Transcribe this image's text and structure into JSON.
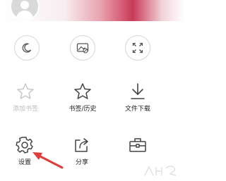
{
  "menu": {
    "tools": [
      {
        "name": "night-mode",
        "icon": "moon-icon",
        "label": ""
      },
      {
        "name": "no-image-mode",
        "icon": "image-off-icon",
        "label": ""
      },
      {
        "name": "fullscreen",
        "icon": "fullscreen-icon",
        "label": ""
      },
      {
        "name": "add-bookmark",
        "icon": "star-icon",
        "label": "添加书签",
        "enabled": false
      },
      {
        "name": "bookmarks-history",
        "icon": "star-icon",
        "label": "书签/历史",
        "enabled": true
      },
      {
        "name": "file-download",
        "icon": "download-icon",
        "label": "文件下载",
        "enabled": true
      },
      {
        "name": "settings",
        "icon": "gear-icon",
        "label": "设置",
        "enabled": true
      },
      {
        "name": "share",
        "icon": "share-icon",
        "label": "分享",
        "enabled": true
      },
      {
        "name": "toolbox",
        "icon": "toolbox-icon",
        "label": "",
        "enabled": true
      }
    ]
  },
  "annotation": {
    "color": "#e23b3b",
    "icon": "arrow-icon"
  },
  "colors": {
    "banner_accent": "#c93a57",
    "icon_stroke": "#555555",
    "disabled": "#bdbdbd"
  }
}
